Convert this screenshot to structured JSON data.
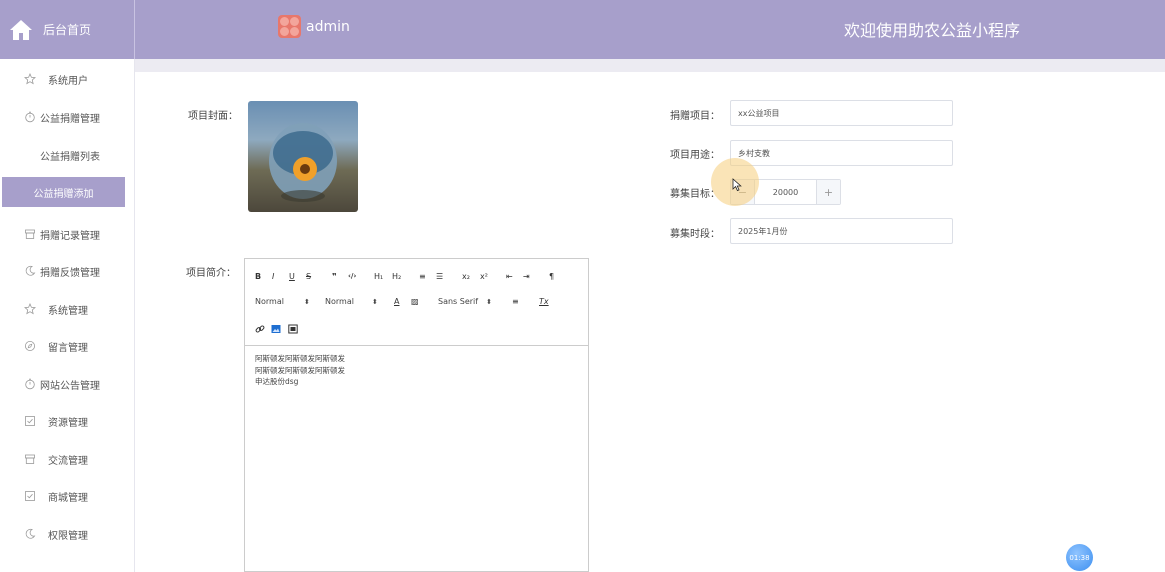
{
  "header": {
    "home_label": "后台首页",
    "admin_name": "admin",
    "welcome": "欢迎使用助农公益小程序"
  },
  "sidebar": {
    "items": [
      {
        "label": "系统用户",
        "icon": "star-icon"
      },
      {
        "label": "公益捐赠管理",
        "icon": "timer-icon"
      },
      {
        "label": "公益捐赠列表"
      },
      {
        "label": "公益捐赠添加",
        "active": true
      },
      {
        "label": "捐赠记录管理",
        "icon": "box-icon"
      },
      {
        "label": "捐赠反馈管理",
        "icon": "moon-icon"
      },
      {
        "label": "系统管理",
        "icon": "star-icon"
      },
      {
        "label": "留言管理",
        "icon": "compass-icon"
      },
      {
        "label": "网站公告管理",
        "icon": "timer-icon"
      },
      {
        "label": "资源管理",
        "icon": "checkbox-icon"
      },
      {
        "label": "交流管理",
        "icon": "box-icon"
      },
      {
        "label": "商城管理",
        "icon": "checkbox-icon"
      },
      {
        "label": "权限管理",
        "icon": "moon-icon"
      }
    ]
  },
  "form": {
    "cover_label": "项目封面：",
    "intro_label": "项目简介：",
    "name_label": "捐赠项目：",
    "name_value": "xx公益项目",
    "use_label": "项目用途：",
    "use_value": "乡村支教",
    "target_label": "募集目标：",
    "target_value": "20000",
    "period_label": "募集时段：",
    "period_value": "2025年1月份"
  },
  "editor": {
    "toolbar": {
      "bold": "B",
      "italic": "I",
      "underline": "U",
      "strike": "S",
      "quote": "❞",
      "code": "‹/›",
      "h1": "H₁",
      "h2": "H₂",
      "ordered": "≡",
      "bullet": "☰",
      "sub": "x₂",
      "sup": "x²",
      "outdent": "⇤",
      "indent": "⇥",
      "direction": "¶",
      "size_select": "Normal",
      "header_select": "Normal",
      "font_select": "Sans Serif",
      "color": "A",
      "align": "≡",
      "clean": "Tx"
    },
    "lines": [
      "阿斯顿发阿斯顿发阿斯顿发",
      "阿斯顿发阿斯顿发阿斯顿发",
      "申达股份dsg"
    ]
  },
  "timer": "01:38",
  "colors": {
    "accent": "#a79fcb",
    "band": "#ecebf2"
  }
}
